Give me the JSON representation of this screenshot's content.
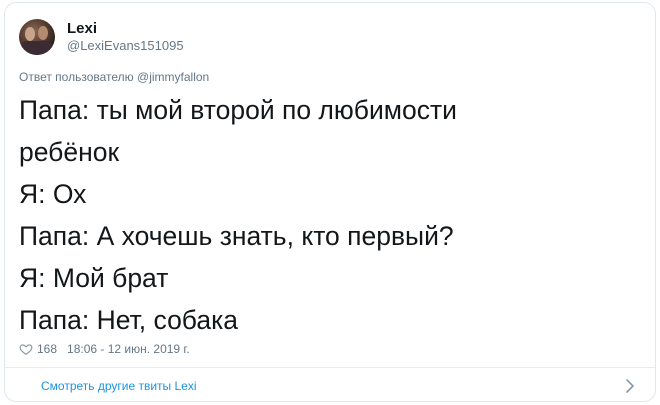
{
  "tweet": {
    "author": {
      "display_name": "Lexi",
      "handle": "@LexiEvans151095",
      "avatar_icon": "user-avatar"
    },
    "reply_to": {
      "prefix": "Ответ пользователю",
      "mention": "@jimmyfallon"
    },
    "lines": [
      "Папа: ты мой второй по любимости",
      "ребёнок",
      "Я: Ох",
      "Папа: А хочешь знать, кто первый?",
      "Я: Мой брат",
      "Папа: Нет, собака"
    ],
    "likes": "168",
    "timestamp": "18:06 - 12 июн. 2019 г.",
    "like_icon": "heart-outline-icon"
  },
  "footer": {
    "link_label": "Смотреть другие твиты Lexi",
    "chevron_icon": "chevron-right-icon",
    "link_color": "#1b95e0"
  }
}
